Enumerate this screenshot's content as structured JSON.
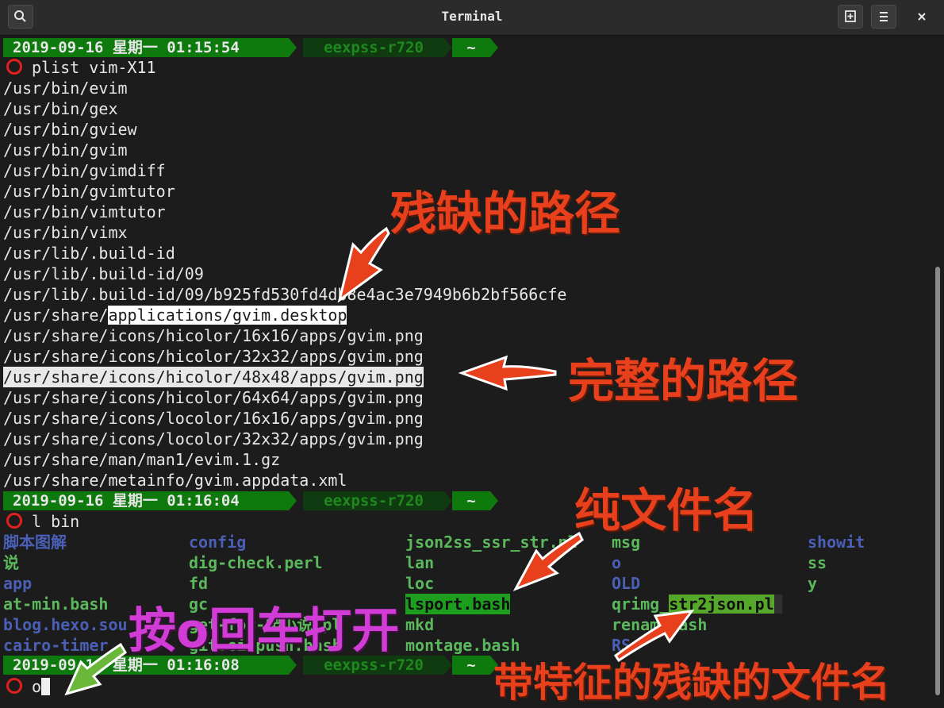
{
  "window": {
    "title": "Terminal"
  },
  "icons": {
    "search": "search-icon",
    "new_tab": "new-tab-icon",
    "menu": "hamburger-menu-icon",
    "close": "close-icon"
  },
  "prompts": [
    {
      "date": "2019-09-16 星期一 01:15:54",
      "host": "eexpss-r720",
      "dir": "~",
      "command": "plist vim-X11"
    },
    {
      "date": "2019-09-16 星期一 01:16:04",
      "host": "eexpss-r720",
      "dir": "~",
      "command": "l bin"
    },
    {
      "date": "2019-09-16 星期一 01:16:08",
      "host": "eexpss-r720",
      "dir": "~",
      "command": "o"
    }
  ],
  "plist_output": [
    "/usr/bin/evim",
    "/usr/bin/gex",
    "/usr/bin/gview",
    "/usr/bin/gvim",
    "/usr/bin/gvimdiff",
    "/usr/bin/gvimtutor",
    "/usr/bin/vimtutor",
    "/usr/bin/vimx",
    "/usr/lib/.build-id",
    "/usr/lib/.build-id/09",
    "/usr/lib/.build-id/09/b925fd530fd4db8e4ac3e7949b6b2bf566cfe"
  ],
  "plist_partial_line": {
    "prefix": "/usr/share/",
    "highlight": "applications/gvim.desktop"
  },
  "plist_output_2": [
    "/usr/share/icons/hicolor/16x16/apps/gvim.png",
    "/usr/share/icons/hicolor/32x32/apps/gvim.png"
  ],
  "plist_full_line": "/usr/share/icons/hicolor/48x48/apps/gvim.png",
  "plist_output_3": [
    "/usr/share/icons/hicolor/64x64/apps/gvim.png",
    "/usr/share/icons/locolor/16x16/apps/gvim.png",
    "/usr/share/icons/locolor/32x32/apps/gvim.png",
    "/usr/share/man/man1/evim.1.gz",
    "/usr/share/metainfo/gvim.appdata.xml"
  ],
  "ls_columns": [
    [
      "脚本图解",
      "说",
      "app",
      "at-min.bash",
      "blog.hexo.sou",
      "cairo-timer"
    ],
    [
      "config",
      "dig-check.perl",
      "fd",
      "gc",
      "get-for-爬小说.pl",
      "git.ci.push.bash"
    ],
    [
      "json2ss_ssr_str.pl",
      "lan",
      "loc",
      "lsport.bash",
      "mkd",
      "montage.bash"
    ],
    [
      "msg",
      "o",
      "OLD",
      "qrimg_",
      "renam.bash",
      "RS"
    ],
    [
      "showit",
      "ss",
      "y"
    ]
  ],
  "ls_highlight_str2json": "str2json.pl",
  "annotations": {
    "partial_path": "残缺的路径",
    "full_path": "完整的路径",
    "pure_filename": "纯文件名",
    "press_o": "按o回车打开",
    "feature_partial_filename": "带特征的残缺的文件名"
  },
  "colors": {
    "date_bg": "#0e7a0e",
    "host_fg": "#1e8a1e",
    "prompt_circle": "#e02020",
    "arrow_red": "#e8401c",
    "arrow_green": "#6ab83a"
  }
}
